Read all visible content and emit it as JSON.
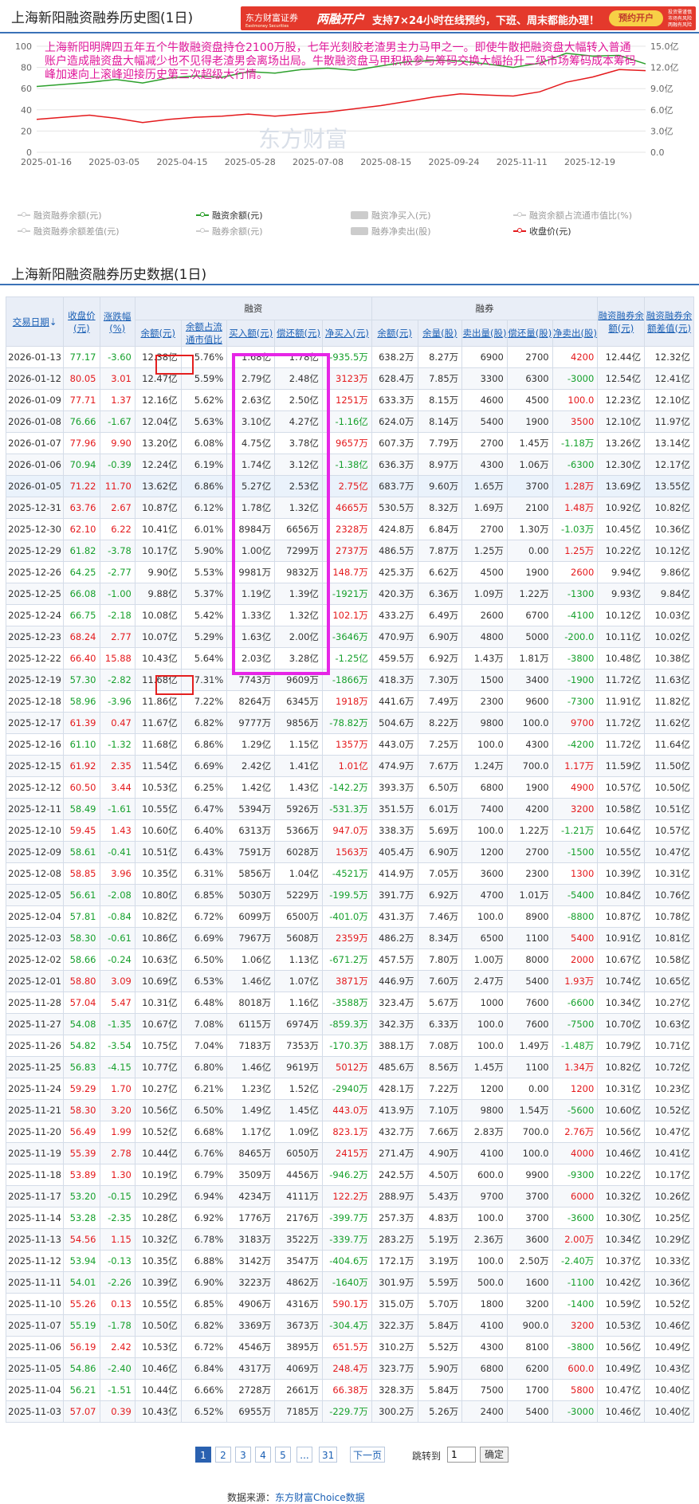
{
  "page_title": "上海新阳融资融券历史图(1日)",
  "banner": {
    "logo": "东方财富证券",
    "logo_sub": "Eastmoney Securities",
    "highlight": "两融开户",
    "text": "支持7×24小时在线预约，下班、周末都能办理！",
    "button": "预约开户",
    "fine_print": "风险提示 投资需谨慎",
    "small": "投资需谨慎 市场有风险 两融有风险",
    "bg_color": "#e4392c"
  },
  "annotation": "上海新阳明牌四五年五个牛散融资盘持仓2100万股，七年光刻胶老渣男主力马甲之一。即使牛散把融资盘大幅转入普通账户造成融资盘大幅减少也不见得老渣男会离场出局。牛散融资盘马甲积极参与筹码交换大幅抬升二级市场筹码成本筹码峰加速向上滚峰迎接历史第三次超级大行情。",
  "watermark": "东方财富",
  "chart_data": {
    "type": "line",
    "x": [
      "2025-01-16",
      "2025-03-05",
      "2025-04-15",
      "2025-05-28",
      "2025-07-08",
      "2025-08-15",
      "2025-09-24",
      "2025-11-11",
      "2025-12-19"
    ],
    "left_axis": {
      "ticks": [
        "0",
        "20",
        "40",
        "60",
        "80",
        "100"
      ],
      "ylim": [
        0,
        100
      ]
    },
    "right_axis": {
      "ticks": [
        "0.0",
        "3.0亿",
        "6.0亿",
        "9.0亿",
        "12.0亿",
        "15.0亿"
      ],
      "ylim": [
        0,
        15
      ]
    },
    "series": [
      {
        "name": "融资余额(元)",
        "axis": "right",
        "color": "#2ca02c",
        "values": [
          9.3,
          9.6,
          9.9,
          10.3,
          9.8,
          10.5,
          10.8,
          10.6,
          11.4,
          11.2,
          11.7,
          11.9,
          11.6,
          12.2,
          12.8,
          13.0,
          12.9,
          12.5,
          12.0,
          12.6,
          14.0,
          13.6,
          13.7,
          12.5
        ]
      },
      {
        "name": "收盘价(元)",
        "axis": "left",
        "color": "#e4191c",
        "values": [
          31,
          33,
          35,
          32,
          28,
          31,
          33,
          34,
          36,
          34,
          36,
          38,
          41,
          44,
          48,
          52,
          55,
          54,
          53,
          57,
          66,
          71,
          78,
          77
        ]
      }
    ],
    "legend": [
      {
        "name": "融资融券余额(元)",
        "color": "#cccccc",
        "shape": "line",
        "active": false
      },
      {
        "name": "融资余额(元)",
        "color": "#2ca02c",
        "shape": "line",
        "active": true
      },
      {
        "name": "融资净买入(元)",
        "color": "#cccccc",
        "shape": "box",
        "active": false
      },
      {
        "name": "融资余额占流通市值比(%)",
        "color": "#cccccc",
        "shape": "line",
        "active": false
      },
      {
        "name": "融资融券余额差值(元)",
        "color": "#cccccc",
        "shape": "line",
        "active": false
      },
      {
        "name": "融券余额(元)",
        "color": "#cccccc",
        "shape": "line",
        "active": false
      },
      {
        "name": "融券净卖出(股)",
        "color": "#cccccc",
        "shape": "box",
        "active": false
      },
      {
        "name": "收盘价(元)",
        "color": "#e4191c",
        "shape": "line",
        "active": true
      }
    ]
  },
  "table_title": "上海新阳融资融券历史数据(1日)",
  "table": {
    "group_headers": {
      "finance": "融资",
      "securities": "融券"
    },
    "headers": [
      "交易日期",
      "收盘价(元)",
      "涨跌幅(%)",
      "余额(元)",
      "余额占流通市值比",
      "买入额(元)",
      "偿还额(元)",
      "净买入(元)",
      "余额(元)",
      "余量(股)",
      "卖出量(股)",
      "偿还量(股)",
      "净卖出(股)",
      "融资融券余额(元)",
      "融资融券余额差值(元)"
    ],
    "rows": [
      [
        "2026-01-13",
        "77.17",
        "-3.60",
        "12.38亿",
        "5.76%",
        "1.68亿",
        "1.78亿",
        "-935.5万",
        "638.2万",
        "8.27万",
        "6900",
        "2700",
        "4200",
        "12.44亿",
        "12.32亿"
      ],
      [
        "2026-01-12",
        "80.05",
        "3.01",
        "12.47亿",
        "5.59%",
        "2.79亿",
        "2.48亿",
        "3123万",
        "628.4万",
        "7.85万",
        "3300",
        "6300",
        "-3000",
        "12.54亿",
        "12.41亿"
      ],
      [
        "2026-01-09",
        "77.71",
        "1.37",
        "12.16亿",
        "5.62%",
        "2.63亿",
        "2.50亿",
        "1251万",
        "633.3万",
        "8.15万",
        "4600",
        "4500",
        "100.0",
        "12.23亿",
        "12.10亿"
      ],
      [
        "2026-01-08",
        "76.66",
        "-1.67",
        "12.04亿",
        "5.63%",
        "3.10亿",
        "4.27亿",
        "-1.16亿",
        "624.0万",
        "8.14万",
        "5400",
        "1900",
        "3500",
        "12.10亿",
        "11.97亿"
      ],
      [
        "2026-01-07",
        "77.96",
        "9.90",
        "13.20亿",
        "6.08%",
        "4.75亿",
        "3.78亿",
        "9657万",
        "607.3万",
        "7.79万",
        "2700",
        "1.45万",
        "-1.18万",
        "13.26亿",
        "13.14亿"
      ],
      [
        "2026-01-06",
        "70.94",
        "-0.39",
        "12.24亿",
        "6.19%",
        "1.74亿",
        "3.12亿",
        "-1.38亿",
        "636.3万",
        "8.97万",
        "4300",
        "1.06万",
        "-6300",
        "12.30亿",
        "12.17亿"
      ],
      [
        "2026-01-05",
        "71.22",
        "11.70",
        "13.62亿",
        "6.86%",
        "5.27亿",
        "2.53亿",
        "2.75亿",
        "683.7万",
        "9.60万",
        "1.65万",
        "3700",
        "1.28万",
        "13.69亿",
        "13.55亿"
      ],
      [
        "2025-12-31",
        "63.76",
        "2.67",
        "10.87亿",
        "6.12%",
        "1.78亿",
        "1.32亿",
        "4665万",
        "530.5万",
        "8.32万",
        "1.69万",
        "2100",
        "1.48万",
        "10.92亿",
        "10.82亿"
      ],
      [
        "2025-12-30",
        "62.10",
        "6.22",
        "10.41亿",
        "6.01%",
        "8984万",
        "6656万",
        "2328万",
        "424.8万",
        "6.84万",
        "2700",
        "1.30万",
        "-1.03万",
        "10.45亿",
        "10.36亿"
      ],
      [
        "2025-12-29",
        "61.82",
        "-3.78",
        "10.17亿",
        "5.90%",
        "1.00亿",
        "7299万",
        "2737万",
        "486.5万",
        "7.87万",
        "1.25万",
        "0.00",
        "1.25万",
        "10.22亿",
        "10.12亿"
      ],
      [
        "2025-12-26",
        "64.25",
        "-2.77",
        "9.90亿",
        "5.53%",
        "9981万",
        "9832万",
        "148.7万",
        "425.3万",
        "6.62万",
        "4500",
        "1900",
        "2600",
        "9.94亿",
        "9.86亿"
      ],
      [
        "2025-12-25",
        "66.08",
        "-1.00",
        "9.88亿",
        "5.37%",
        "1.19亿",
        "1.39亿",
        "-1921万",
        "420.3万",
        "6.36万",
        "1.09万",
        "1.22万",
        "-1300",
        "9.93亿",
        "9.84亿"
      ],
      [
        "2025-12-24",
        "66.75",
        "-2.18",
        "10.08亿",
        "5.42%",
        "1.33亿",
        "1.32亿",
        "102.1万",
        "433.2万",
        "6.49万",
        "2600",
        "6700",
        "-4100",
        "10.12亿",
        "10.03亿"
      ],
      [
        "2025-12-23",
        "68.24",
        "2.77",
        "10.07亿",
        "5.29%",
        "1.63亿",
        "2.00亿",
        "-3646万",
        "470.9万",
        "6.90万",
        "4800",
        "5000",
        "-200.0",
        "10.11亿",
        "10.02亿"
      ],
      [
        "2025-12-22",
        "66.40",
        "15.88",
        "10.43亿",
        "5.64%",
        "2.03亿",
        "3.28亿",
        "-1.25亿",
        "459.5万",
        "6.92万",
        "1.43万",
        "1.81万",
        "-3800",
        "10.48亿",
        "10.38亿"
      ],
      [
        "2025-12-19",
        "57.30",
        "-2.82",
        "11.68亿",
        "7.31%",
        "7743万",
        "9609万",
        "-1866万",
        "418.3万",
        "7.30万",
        "1500",
        "3400",
        "-1900",
        "11.72亿",
        "11.63亿"
      ],
      [
        "2025-12-18",
        "58.96",
        "-3.96",
        "11.86亿",
        "7.22%",
        "8264万",
        "6345万",
        "1918万",
        "441.6万",
        "7.49万",
        "2300",
        "9600",
        "-7300",
        "11.91亿",
        "11.82亿"
      ],
      [
        "2025-12-17",
        "61.39",
        "0.47",
        "11.67亿",
        "6.82%",
        "9777万",
        "9856万",
        "-78.82万",
        "504.6万",
        "8.22万",
        "9800",
        "100.0",
        "9700",
        "11.72亿",
        "11.62亿"
      ],
      [
        "2025-12-16",
        "61.10",
        "-1.32",
        "11.68亿",
        "6.86%",
        "1.29亿",
        "1.15亿",
        "1357万",
        "443.0万",
        "7.25万",
        "100.0",
        "4300",
        "-4200",
        "11.72亿",
        "11.64亿"
      ],
      [
        "2025-12-15",
        "61.92",
        "2.35",
        "11.54亿",
        "6.69%",
        "2.42亿",
        "1.41亿",
        "1.01亿",
        "474.9万",
        "7.67万",
        "1.24万",
        "700.0",
        "1.17万",
        "11.59亿",
        "11.50亿"
      ],
      [
        "2025-12-12",
        "60.50",
        "3.44",
        "10.53亿",
        "6.25%",
        "1.42亿",
        "1.43亿",
        "-142.2万",
        "393.3万",
        "6.50万",
        "6800",
        "1900",
        "4900",
        "10.57亿",
        "10.50亿"
      ],
      [
        "2025-12-11",
        "58.49",
        "-1.61",
        "10.55亿",
        "6.47%",
        "5394万",
        "5926万",
        "-531.3万",
        "351.5万",
        "6.01万",
        "7400",
        "4200",
        "3200",
        "10.58亿",
        "10.51亿"
      ],
      [
        "2025-12-10",
        "59.45",
        "1.43",
        "10.60亿",
        "6.40%",
        "6313万",
        "5366万",
        "947.0万",
        "338.3万",
        "5.69万",
        "100.0",
        "1.22万",
        "-1.21万",
        "10.64亿",
        "10.57亿"
      ],
      [
        "2025-12-09",
        "58.61",
        "-0.41",
        "10.51亿",
        "6.43%",
        "7591万",
        "6028万",
        "1563万",
        "405.4万",
        "6.90万",
        "1200",
        "2700",
        "-1500",
        "10.55亿",
        "10.47亿"
      ],
      [
        "2025-12-08",
        "58.85",
        "3.96",
        "10.35亿",
        "6.31%",
        "5856万",
        "1.04亿",
        "-4521万",
        "414.9万",
        "7.05万",
        "3600",
        "2300",
        "1300",
        "10.39亿",
        "10.31亿"
      ],
      [
        "2025-12-05",
        "56.61",
        "-2.08",
        "10.80亿",
        "6.85%",
        "5030万",
        "5229万",
        "-199.5万",
        "391.7万",
        "6.92万",
        "4700",
        "1.01万",
        "-5400",
        "10.84亿",
        "10.76亿"
      ],
      [
        "2025-12-04",
        "57.81",
        "-0.84",
        "10.82亿",
        "6.72%",
        "6099万",
        "6500万",
        "-401.0万",
        "431.3万",
        "7.46万",
        "100.0",
        "8900",
        "-8800",
        "10.87亿",
        "10.78亿"
      ],
      [
        "2025-12-03",
        "58.30",
        "-0.61",
        "10.86亿",
        "6.69%",
        "7967万",
        "5608万",
        "2359万",
        "486.2万",
        "8.34万",
        "6500",
        "1100",
        "5400",
        "10.91亿",
        "10.81亿"
      ],
      [
        "2025-12-02",
        "58.66",
        "-0.24",
        "10.63亿",
        "6.50%",
        "1.06亿",
        "1.13亿",
        "-671.2万",
        "457.5万",
        "7.80万",
        "1.00万",
        "8000",
        "2000",
        "10.67亿",
        "10.58亿"
      ],
      [
        "2025-12-01",
        "58.80",
        "3.09",
        "10.69亿",
        "6.53%",
        "1.46亿",
        "1.07亿",
        "3871万",
        "446.9万",
        "7.60万",
        "2.47万",
        "5400",
        "1.93万",
        "10.74亿",
        "10.65亿"
      ],
      [
        "2025-11-28",
        "57.04",
        "5.47",
        "10.31亿",
        "6.48%",
        "8018万",
        "1.16亿",
        "-3588万",
        "323.4万",
        "5.67万",
        "1000",
        "7600",
        "-6600",
        "10.34亿",
        "10.27亿"
      ],
      [
        "2025-11-27",
        "54.08",
        "-1.35",
        "10.67亿",
        "7.08%",
        "6115万",
        "6974万",
        "-859.3万",
        "342.3万",
        "6.33万",
        "100.0",
        "7600",
        "-7500",
        "10.70亿",
        "10.63亿"
      ],
      [
        "2025-11-26",
        "54.82",
        "-3.54",
        "10.75亿",
        "7.04%",
        "7183万",
        "7353万",
        "-170.3万",
        "388.1万",
        "7.08万",
        "100.0",
        "1.49万",
        "-1.48万",
        "10.79亿",
        "10.71亿"
      ],
      [
        "2025-11-25",
        "56.83",
        "-4.15",
        "10.77亿",
        "6.80%",
        "1.46亿",
        "9619万",
        "5012万",
        "485.6万",
        "8.56万",
        "1.45万",
        "1100",
        "1.34万",
        "10.82亿",
        "10.72亿"
      ],
      [
        "2025-11-24",
        "59.29",
        "1.70",
        "10.27亿",
        "6.21%",
        "1.23亿",
        "1.52亿",
        "-2940万",
        "428.1万",
        "7.22万",
        "1200",
        "0.00",
        "1200",
        "10.31亿",
        "10.23亿"
      ],
      [
        "2025-11-21",
        "58.30",
        "3.20",
        "10.56亿",
        "6.50%",
        "1.49亿",
        "1.45亿",
        "443.0万",
        "413.9万",
        "7.10万",
        "9800",
        "1.54万",
        "-5600",
        "10.60亿",
        "10.52亿"
      ],
      [
        "2025-11-20",
        "56.49",
        "1.99",
        "10.52亿",
        "6.68%",
        "1.17亿",
        "1.09亿",
        "823.1万",
        "432.7万",
        "7.66万",
        "2.83万",
        "700.0",
        "2.76万",
        "10.56亿",
        "10.47亿"
      ],
      [
        "2025-11-19",
        "55.39",
        "2.78",
        "10.44亿",
        "6.76%",
        "8465万",
        "6050万",
        "2415万",
        "271.4万",
        "4.90万",
        "4100",
        "100.0",
        "4000",
        "10.46亿",
        "10.41亿"
      ],
      [
        "2025-11-18",
        "53.89",
        "1.30",
        "10.19亿",
        "6.79%",
        "3509万",
        "4456万",
        "-946.2万",
        "242.5万",
        "4.50万",
        "600.0",
        "9900",
        "-9300",
        "10.22亿",
        "10.17亿"
      ],
      [
        "2025-11-17",
        "53.20",
        "-0.15",
        "10.29亿",
        "6.94%",
        "4234万",
        "4111万",
        "122.2万",
        "288.9万",
        "5.43万",
        "9700",
        "3700",
        "6000",
        "10.32亿",
        "10.26亿"
      ],
      [
        "2025-11-14",
        "53.28",
        "-2.35",
        "10.28亿",
        "6.92%",
        "1776万",
        "2176万",
        "-399.7万",
        "257.3万",
        "4.83万",
        "100.0",
        "3700",
        "-3600",
        "10.30亿",
        "10.25亿"
      ],
      [
        "2025-11-13",
        "54.56",
        "1.15",
        "10.32亿",
        "6.78%",
        "3183万",
        "3522万",
        "-339.7万",
        "283.2万",
        "5.19万",
        "2.36万",
        "3600",
        "2.00万",
        "10.34亿",
        "10.29亿"
      ],
      [
        "2025-11-12",
        "53.94",
        "-0.13",
        "10.35亿",
        "6.88%",
        "3142万",
        "3547万",
        "-404.6万",
        "172.1万",
        "3.19万",
        "100.0",
        "2.50万",
        "-2.40万",
        "10.37亿",
        "10.33亿"
      ],
      [
        "2025-11-11",
        "54.01",
        "-2.26",
        "10.39亿",
        "6.90%",
        "3223万",
        "4862万",
        "-1640万",
        "301.9万",
        "5.59万",
        "500.0",
        "1600",
        "-1100",
        "10.42亿",
        "10.36亿"
      ],
      [
        "2025-11-10",
        "55.26",
        "0.13",
        "10.55亿",
        "6.85%",
        "4906万",
        "4316万",
        "590.1万",
        "315.0万",
        "5.70万",
        "1800",
        "3200",
        "-1400",
        "10.59亿",
        "10.52亿"
      ],
      [
        "2025-11-07",
        "55.19",
        "-1.78",
        "10.50亿",
        "6.82%",
        "3369万",
        "3673万",
        "-304.4万",
        "322.3万",
        "5.84万",
        "4100",
        "900.0",
        "3200",
        "10.53亿",
        "10.46亿"
      ],
      [
        "2025-11-06",
        "56.19",
        "2.42",
        "10.53亿",
        "6.72%",
        "4546万",
        "3895万",
        "651.5万",
        "310.2万",
        "5.52万",
        "4300",
        "8100",
        "-3800",
        "10.56亿",
        "10.49亿"
      ],
      [
        "2025-11-05",
        "54.86",
        "-2.40",
        "10.46亿",
        "6.84%",
        "4317万",
        "4069万",
        "248.4万",
        "323.7万",
        "5.90万",
        "6800",
        "6200",
        "600.0",
        "10.49亿",
        "10.43亿"
      ],
      [
        "2025-11-04",
        "56.21",
        "-1.51",
        "10.44亿",
        "6.66%",
        "2728万",
        "2661万",
        "66.38万",
        "328.3万",
        "5.84万",
        "7500",
        "1700",
        "5800",
        "10.47亿",
        "10.40亿"
      ],
      [
        "2025-11-03",
        "57.07",
        "0.39",
        "10.43亿",
        "6.52%",
        "6955万",
        "7185万",
        "-229.7万",
        "300.2万",
        "5.26万",
        "2400",
        "5400",
        "-3000",
        "10.46亿",
        "10.40亿"
      ]
    ]
  },
  "pagination": {
    "pages": [
      "1",
      "2",
      "3",
      "4",
      "5",
      "...",
      "31"
    ],
    "next": "下一页",
    "jump_label": "跳转到",
    "jump_value": "1",
    "confirm": "确定"
  },
  "footer": {
    "prefix": "数据来源：",
    "source": "东方财富Choice数据"
  }
}
